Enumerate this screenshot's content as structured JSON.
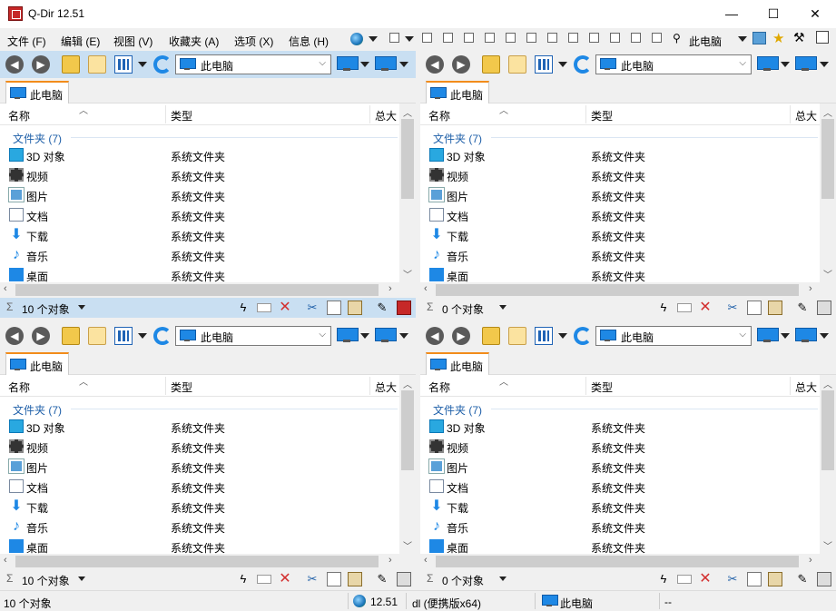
{
  "window": {
    "title": "Q-Dir 12.51",
    "minimize": "—",
    "maximize": "☐",
    "close": "✕"
  },
  "menu": [
    "文件 (F)",
    "编辑 (E)",
    "视图 (V)",
    "收藏夹 (A)",
    "选项 (X)",
    "信息 (H)"
  ],
  "toolbar": {
    "location": "此电脑"
  },
  "panes": [
    {
      "address": "此电脑",
      "tab": "此电脑",
      "columns": {
        "name": "名称",
        "type": "类型",
        "size": "总大"
      },
      "group": "文件夹 (7)",
      "rows": [
        {
          "name": "3D 对象",
          "type": "系统文件夹",
          "icon": "3d-objects-icon"
        },
        {
          "name": "视频",
          "type": "系统文件夹",
          "icon": "video-icon"
        },
        {
          "name": "图片",
          "type": "系统文件夹",
          "icon": "picture-icon"
        },
        {
          "name": "文档",
          "type": "系统文件夹",
          "icon": "document-icon"
        },
        {
          "name": "下载",
          "type": "系统文件夹",
          "icon": "download-icon"
        },
        {
          "name": "音乐",
          "type": "系统文件夹",
          "icon": "music-icon"
        },
        {
          "name": "桌面",
          "type": "系统文件夹",
          "icon": "desktop-icon"
        }
      ],
      "status": "10 个对象"
    },
    {
      "address": "此电脑",
      "tab": "此电脑",
      "columns": {
        "name": "名称",
        "type": "类型",
        "size": "总大"
      },
      "group": "文件夹 (7)",
      "rows": [
        {
          "name": "3D 对象",
          "type": "系统文件夹",
          "icon": "3d-objects-icon"
        },
        {
          "name": "视频",
          "type": "系统文件夹",
          "icon": "video-icon"
        },
        {
          "name": "图片",
          "type": "系统文件夹",
          "icon": "picture-icon"
        },
        {
          "name": "文档",
          "type": "系统文件夹",
          "icon": "document-icon"
        },
        {
          "name": "下载",
          "type": "系统文件夹",
          "icon": "download-icon"
        },
        {
          "name": "音乐",
          "type": "系统文件夹",
          "icon": "music-icon"
        },
        {
          "name": "桌面",
          "type": "系统文件夹",
          "icon": "desktop-icon"
        }
      ],
      "status": "0 个对象"
    },
    {
      "address": "此电脑",
      "tab": "此电脑",
      "columns": {
        "name": "名称",
        "type": "类型",
        "size": "总大"
      },
      "group": "文件夹 (7)",
      "rows": [
        {
          "name": "3D 对象",
          "type": "系统文件夹",
          "icon": "3d-objects-icon"
        },
        {
          "name": "视频",
          "type": "系统文件夹",
          "icon": "video-icon"
        },
        {
          "name": "图片",
          "type": "系统文件夹",
          "icon": "picture-icon"
        },
        {
          "name": "文档",
          "type": "系统文件夹",
          "icon": "document-icon"
        },
        {
          "name": "下载",
          "type": "系统文件夹",
          "icon": "download-icon"
        },
        {
          "name": "音乐",
          "type": "系统文件夹",
          "icon": "music-icon"
        },
        {
          "name": "桌面",
          "type": "系统文件夹",
          "icon": "desktop-icon"
        }
      ],
      "status": "10 个对象"
    },
    {
      "address": "此电脑",
      "tab": "此电脑",
      "columns": {
        "name": "名称",
        "type": "类型",
        "size": "总大"
      },
      "group": "文件夹 (7)",
      "rows": [
        {
          "name": "3D 对象",
          "type": "系统文件夹",
          "icon": "3d-objects-icon"
        },
        {
          "name": "视频",
          "type": "系统文件夹",
          "icon": "video-icon"
        },
        {
          "name": "图片",
          "type": "系统文件夹",
          "icon": "picture-icon"
        },
        {
          "name": "文档",
          "type": "系统文件夹",
          "icon": "document-icon"
        },
        {
          "name": "下载",
          "type": "系统文件夹",
          "icon": "download-icon"
        },
        {
          "name": "音乐",
          "type": "系统文件夹",
          "icon": "music-icon"
        },
        {
          "name": "桌面",
          "type": "系统文件夹",
          "icon": "desktop-icon"
        }
      ],
      "status": "0 个对象"
    }
  ],
  "statusbar": {
    "count": "10 个对象",
    "version": "12.51",
    "edition": "dl (便携版x64)",
    "location": "此电脑",
    "extra": "--"
  },
  "colors": {
    "active_pane": "#c9dff2",
    "accent": "#1e88e5",
    "tab_border": "#f28c1b"
  }
}
